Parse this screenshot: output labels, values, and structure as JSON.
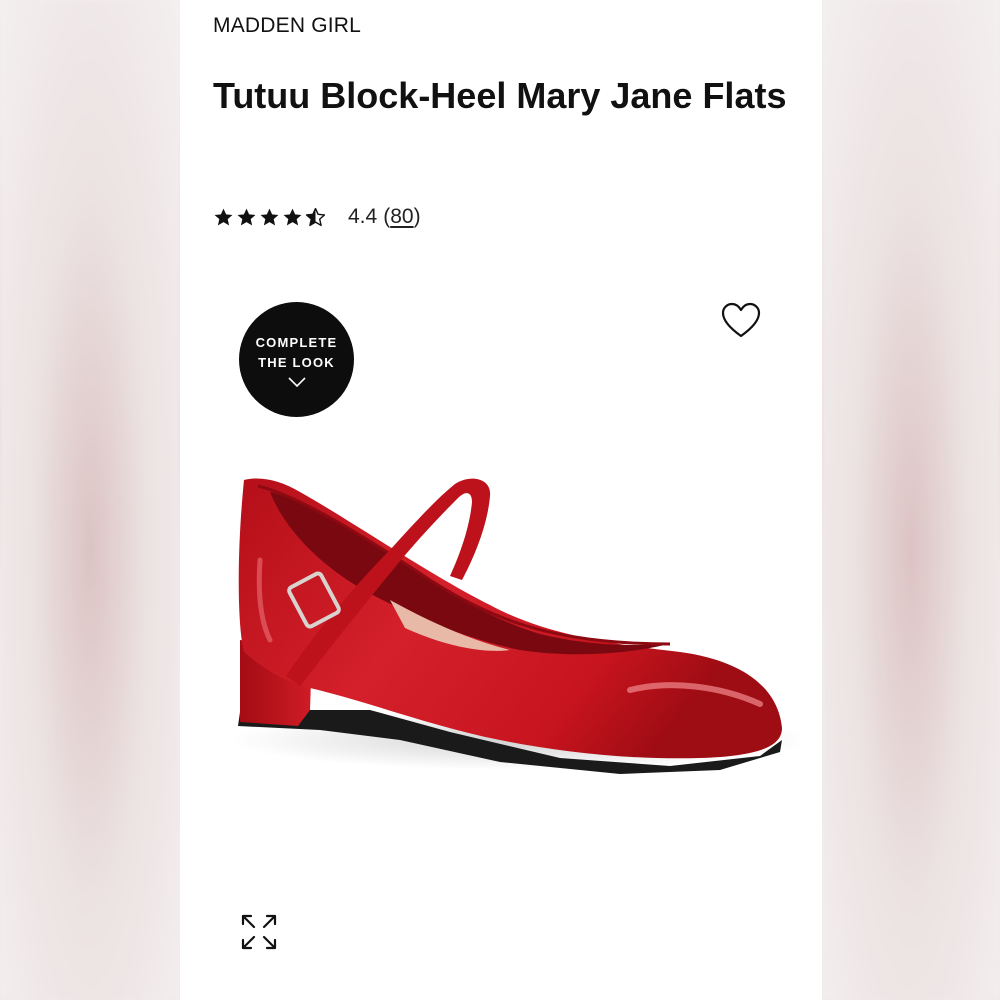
{
  "product": {
    "brand": "MADDEN GIRL",
    "title": "Tutuu Block-Heel Mary Jane Flats",
    "rating": {
      "stars": 4.5,
      "value": "4.4",
      "count": "80",
      "count_open": "(",
      "count_close": ")"
    }
  },
  "complete_look": {
    "line1": "COMPLETE",
    "line2": "THE LOOK",
    "icon": "chevron-down-icon"
  },
  "icons": {
    "favorite": "heart-icon",
    "expand": "expand-icon",
    "star": "star-icon"
  },
  "colors": {
    "shoe_red": "#c8141e",
    "text": "#111111",
    "badge_bg": "#0d0d0d"
  }
}
